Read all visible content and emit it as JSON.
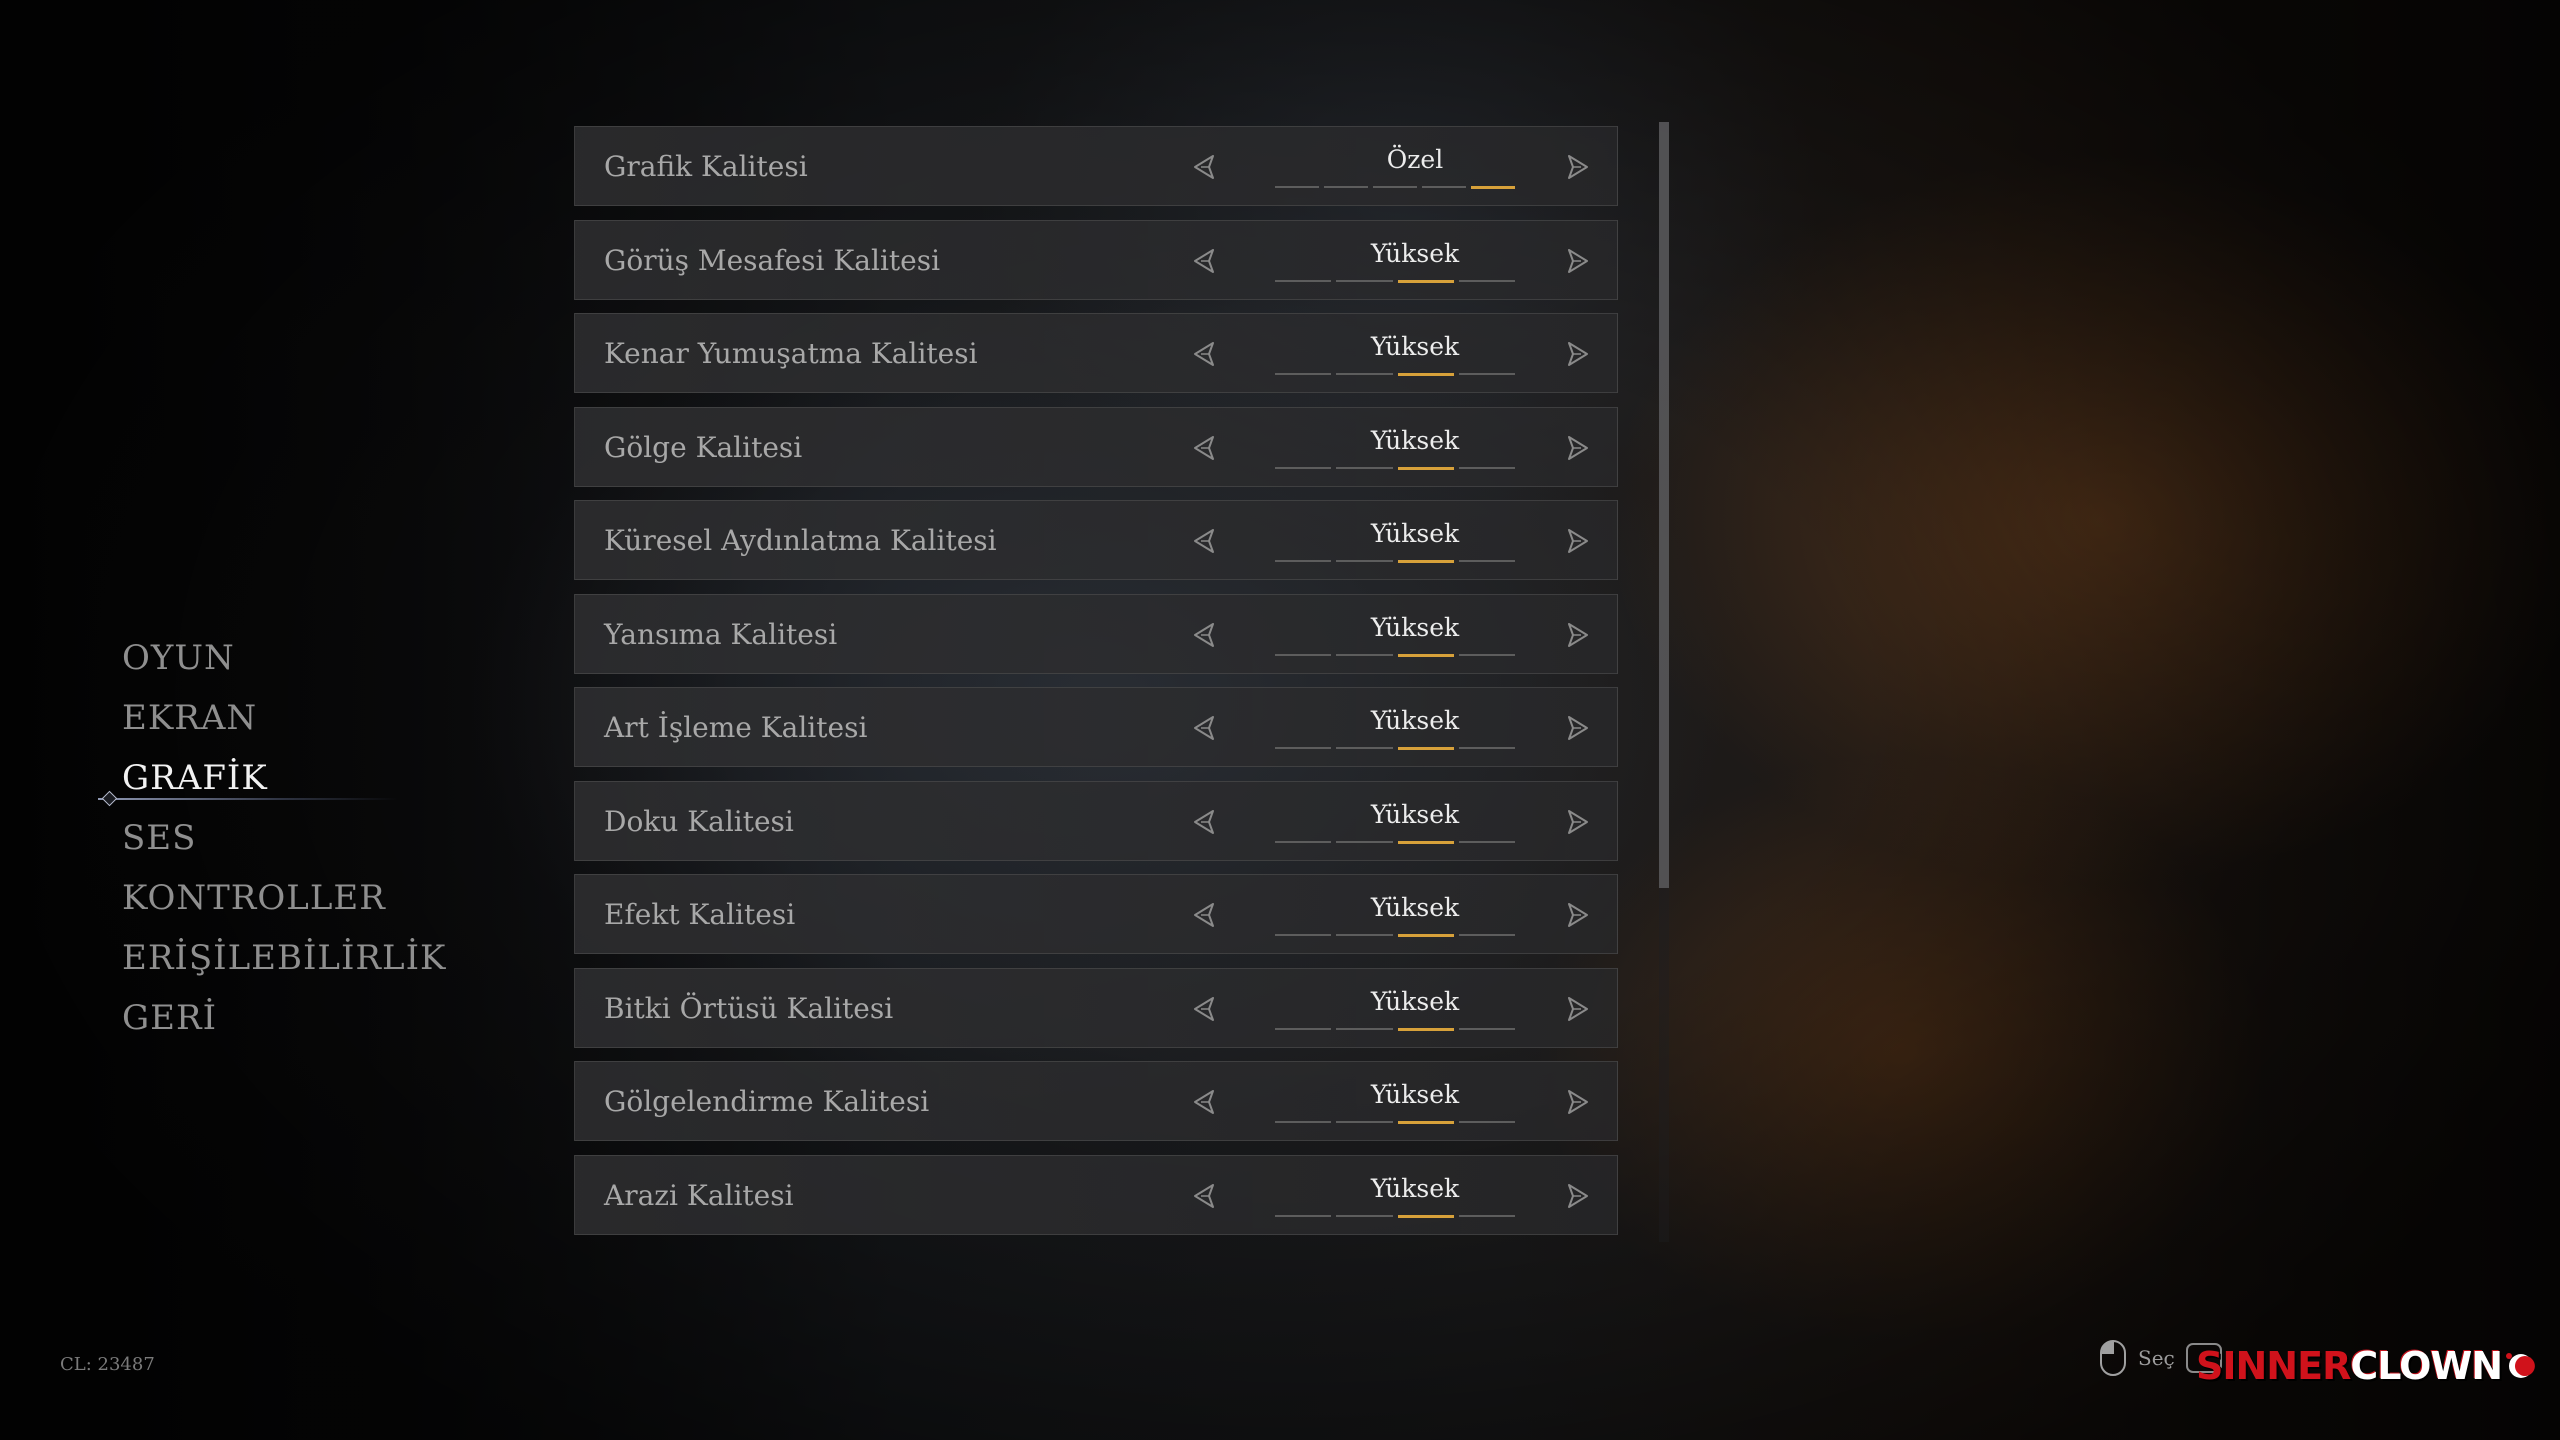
{
  "nav": {
    "items": [
      {
        "label": "OYUN"
      },
      {
        "label": "EKRAN"
      },
      {
        "label": "GRAFİK"
      },
      {
        "label": "SES"
      },
      {
        "label": "KONTROLLER"
      },
      {
        "label": "ERİŞİLEBİLİRLİK"
      },
      {
        "label": "GERİ"
      }
    ],
    "active_index": 2
  },
  "settings": [
    {
      "label": "Grafik Kalitesi",
      "value": "Özel",
      "level": 5,
      "steps": 5
    },
    {
      "label": "Görüş Mesafesi Kalitesi",
      "value": "Yüksek",
      "level": 3,
      "steps": 4
    },
    {
      "label": "Kenar Yumuşatma Kalitesi",
      "value": "Yüksek",
      "level": 3,
      "steps": 4
    },
    {
      "label": "Gölge Kalitesi",
      "value": "Yüksek",
      "level": 3,
      "steps": 4
    },
    {
      "label": "Küresel Aydınlatma Kalitesi",
      "value": "Yüksek",
      "level": 3,
      "steps": 4
    },
    {
      "label": "Yansıma Kalitesi",
      "value": "Yüksek",
      "level": 3,
      "steps": 4
    },
    {
      "label": "Art İşleme Kalitesi",
      "value": "Yüksek",
      "level": 3,
      "steps": 4
    },
    {
      "label": "Doku Kalitesi",
      "value": "Yüksek",
      "level": 3,
      "steps": 4
    },
    {
      "label": "Efekt Kalitesi",
      "value": "Yüksek",
      "level": 3,
      "steps": 4
    },
    {
      "label": "Bitki Örtüsü Kalitesi",
      "value": "Yüksek",
      "level": 3,
      "steps": 4
    },
    {
      "label": "Gölgelendirme Kalitesi",
      "value": "Yüksek",
      "level": 3,
      "steps": 4
    },
    {
      "label": "Arazi Kalitesi",
      "value": "Yüksek",
      "level": 3,
      "steps": 4
    }
  ],
  "footer": {
    "build": "CL: 23487",
    "hint_select": "Seç",
    "logo_part1": "SINNER",
    "logo_part2": "CLOWN"
  },
  "colors": {
    "accent": "#d7a13a",
    "segment_off": "#5d5d5d",
    "nav_active": "#f2f2f2",
    "nav_inactive": "#8f8f8f",
    "logo_red": "#d0121b"
  },
  "icons": {
    "arrow_left": "chevron-left-icon",
    "arrow_right": "chevron-right-icon",
    "mouse": "mouse-icon"
  }
}
